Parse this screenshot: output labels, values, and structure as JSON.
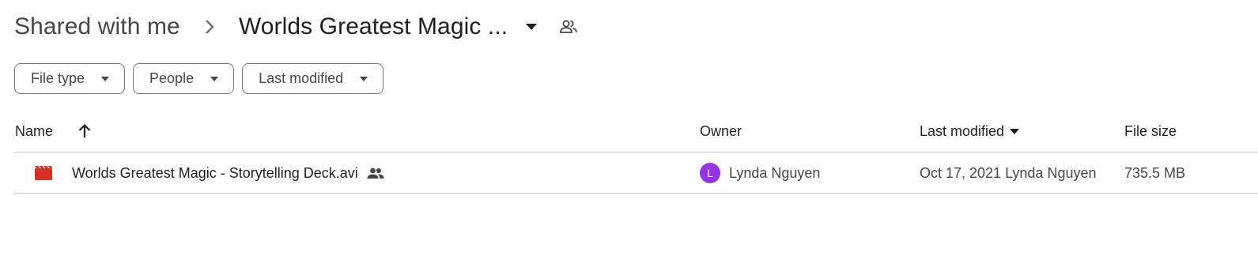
{
  "breadcrumb": {
    "root": "Shared with me",
    "current": "Worlds Greatest Magic ...",
    "icons": [
      "chevron-right-icon",
      "dropdown-arrow-icon",
      "shared-folder-people-icon"
    ]
  },
  "filters": [
    {
      "label": "File type",
      "icon": "caret-down-icon"
    },
    {
      "label": "People",
      "icon": "caret-down-icon"
    },
    {
      "label": "Last modified",
      "icon": "caret-down-icon"
    }
  ],
  "table": {
    "headers": {
      "name": "Name",
      "owner": "Owner",
      "last_modified": "Last modified",
      "file_size": "File size"
    },
    "sort_icon": "arrow-up-icon",
    "rows": [
      {
        "file_icon": "video-file-icon",
        "name": "Worlds Greatest Magic - Storytelling Deck.avi",
        "shared": true,
        "owner_initial": "L",
        "owner": "Lynda Nguyen",
        "last_modified": "Oct 17, 2021 Lynda Nguyen",
        "file_size": "735.5 MB"
      }
    ]
  },
  "colors": {
    "video_icon": "#d93025",
    "avatar": "#9334e6",
    "divider": "#c7c7c7",
    "chip_border": "#747775"
  }
}
